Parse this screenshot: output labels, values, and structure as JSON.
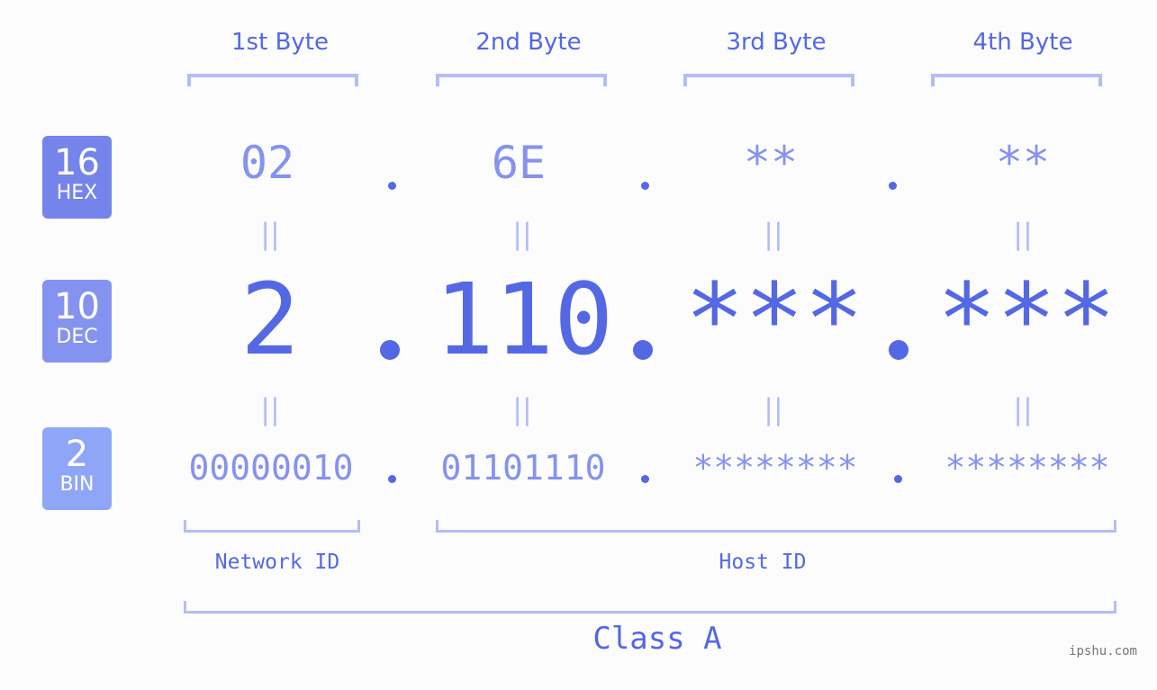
{
  "bytes": [
    {
      "label": "1st Byte",
      "hex": "02",
      "dec": "2",
      "bin": "00000010"
    },
    {
      "label": "2nd Byte",
      "hex": "6E",
      "dec": "110",
      "bin": "01101110"
    },
    {
      "label": "3rd Byte",
      "hex": "**",
      "dec": "***",
      "bin": "********"
    },
    {
      "label": "4th Byte",
      "hex": "**",
      "dec": "***",
      "bin": "********"
    }
  ],
  "badges": {
    "hex": {
      "num": "16",
      "label": "HEX",
      "color": "#7584ea"
    },
    "dec": {
      "num": "10",
      "label": "DEC",
      "color": "#8593f0"
    },
    "bin": {
      "num": "2",
      "label": "BIN",
      "color": "#8fa6f8"
    }
  },
  "equals_symbol": "||",
  "segments": {
    "network": "Network ID",
    "host": "Host ID"
  },
  "class_label": "Class A",
  "watermark": "ipshu.com",
  "colors": {
    "primary": "#5468e4",
    "secondary": "#8592ee",
    "bracket": "#b3bdf6"
  }
}
